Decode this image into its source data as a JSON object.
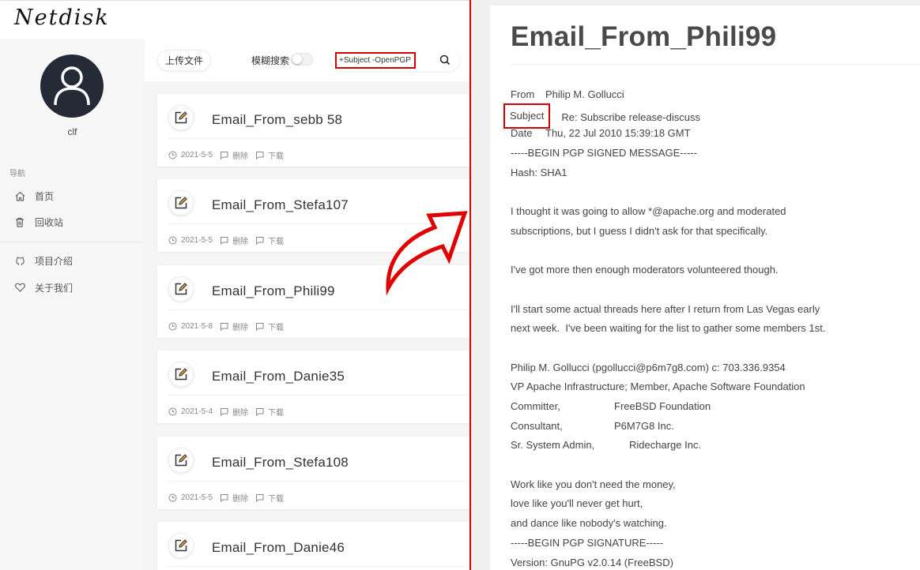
{
  "app": {
    "logo": "Netdisk",
    "user": {
      "name": "clf"
    },
    "nav": {
      "title": "导航",
      "items": [
        {
          "label": "首页",
          "icon": "home-icon"
        },
        {
          "label": "回收站",
          "icon": "trash-icon"
        },
        {
          "label": "项目介绍",
          "icon": "github-icon"
        },
        {
          "label": "关于我们",
          "icon": "heart-icon"
        }
      ]
    },
    "toolbar": {
      "upload_label": "上传文件",
      "fuzzy_label": "模糊搜索",
      "fuzzy_enabled": false,
      "search_value": "+Subject -OpenPGP"
    },
    "files": [
      {
        "name": "Email_From_sebb 58",
        "date": "2021-5-5",
        "delete": "删除",
        "download": "下载"
      },
      {
        "name": "Email_From_Stefa107",
        "date": "2021-5-5",
        "delete": "删除",
        "download": "下载"
      },
      {
        "name": "Email_From_Phili99",
        "date": "2021-5-8",
        "delete": "删除",
        "download": "下载"
      },
      {
        "name": "Email_From_Danie35",
        "date": "2021-5-4",
        "delete": "删除",
        "download": "下载"
      },
      {
        "name": "Email_From_Stefa108",
        "date": "2021-5-5",
        "delete": "删除",
        "download": "下载"
      },
      {
        "name": "Email_From_Danie46",
        "date": "",
        "delete": "",
        "download": ""
      }
    ]
  },
  "colors": {
    "highlight": "#d40000",
    "avatar_bg": "#252a37"
  },
  "email": {
    "title": "Email_From_Phili99",
    "from_label": "From",
    "from_value": "Philip M. Gollucci",
    "subject_label": "Subject",
    "subject_value": "Re: Subscribe release-discuss",
    "date_label": "Date",
    "date_value": "Thu, 22 Jul 2010 15:39:18 GMT",
    "lines": [
      "-----BEGIN PGP SIGNED MESSAGE-----",
      "Hash: SHA1",
      "",
      "I thought it was going to allow *@apache.org and moderated",
      "subscriptions, but I guess I didn't ask for that specifically.",
      "",
      "I've got more then enough moderators volunteered though.",
      "",
      "I'll start some actual threads here after I return from Las Vegas early",
      "next week.  I've been waiting for the list to gather some members 1st.",
      "",
      "Philip M. Gollucci (pgollucci@p6m7g8.com) c: 703.336.9354",
      "VP Apache Infrastructure; Member, Apache Software Foundation"
    ],
    "sig_rows": [
      {
        "k": "Committer,",
        "v": "FreeBSD Foundation",
        "wide": false
      },
      {
        "k": "Consultant,",
        "v": "P6M7G8 Inc.",
        "wide": false
      },
      {
        "k": "Sr. System Admin,",
        "v": "Ridecharge Inc.",
        "wide": true
      }
    ],
    "tail_lines": [
      "",
      "Work like you don't need the money,",
      "love like you'll never get hurt,",
      "and dance like nobody's watching.",
      "-----BEGIN PGP SIGNATURE-----",
      "Version: GnuPG v2.0.14 (FreeBSD)"
    ]
  }
}
